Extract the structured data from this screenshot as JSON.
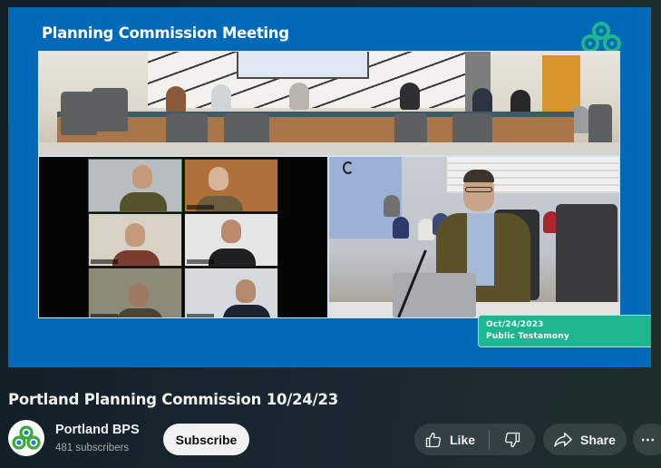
{
  "player": {
    "slide_title": "Planning Commission Meeting",
    "lower_third": {
      "date": "Oct/24/2023",
      "label": "Public Testamony"
    },
    "brand_colors": {
      "slide_background": "#0069b8",
      "logo_green": "#1fb68f",
      "lower_third_background": "#1fb68f"
    },
    "panels": [
      "room-camera",
      "zoom-gallery",
      "podium-camera"
    ],
    "gallery_tile_count": 6
  },
  "video": {
    "title": "Portland Planning Commission 10/24/23"
  },
  "channel": {
    "name": "Portland BPS",
    "subscribers": "481 subscribers",
    "avatar_icon": "portland-bps-logo"
  },
  "actions": {
    "subscribe_label": "Subscribe",
    "like_label": "Like",
    "like_icon": "thumbs-up-icon",
    "dislike_icon": "thumbs-down-icon",
    "share_label": "Share",
    "share_icon": "share-arrow-icon",
    "more_label": "⋯"
  }
}
